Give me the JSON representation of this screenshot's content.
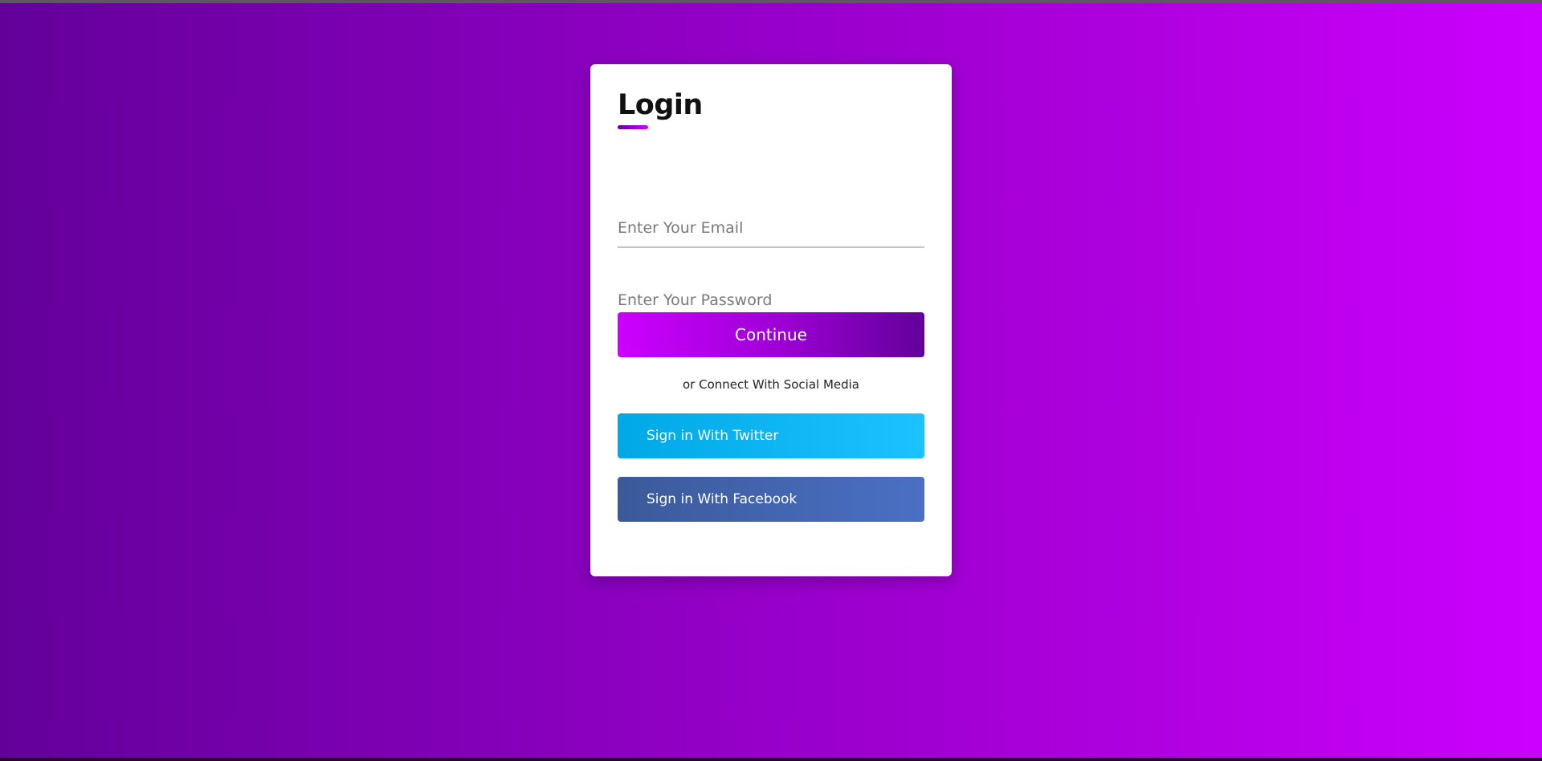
{
  "login": {
    "title": "Login",
    "email_placeholder": "Enter Your Email",
    "password_placeholder": "Enter Your Password",
    "continue_label": "Continue",
    "social_text": "or Connect With Social Media",
    "twitter_label": "Sign in With Twitter",
    "facebook_label": "Sign in With Facebook"
  },
  "colors": {
    "background_start": "#63009a",
    "background_end": "#cc00ff",
    "twitter": "#1cc2ff",
    "facebook": "#4a70c4"
  }
}
